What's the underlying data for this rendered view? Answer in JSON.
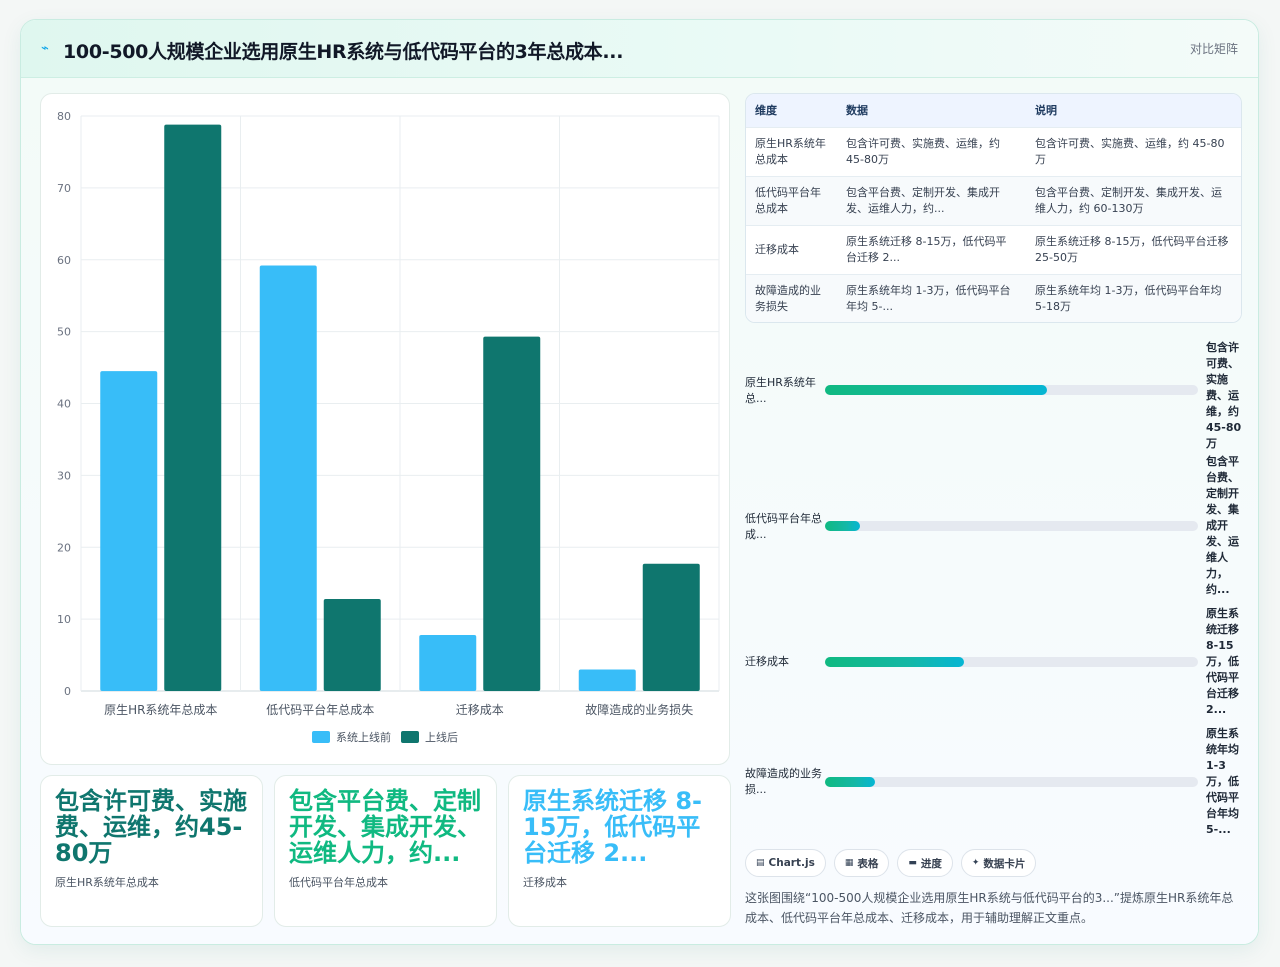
{
  "header": {
    "title": "100-500人规模企业选用原生HR系统与低代码平台的3年总成本...",
    "tag": "对比矩阵"
  },
  "chart_data": {
    "type": "bar",
    "categories": [
      "原生HR系统年总成本",
      "低代码平台年总成本",
      "迁移成本",
      "故障造成的业务损失"
    ],
    "series": [
      {
        "name": "系统上线前",
        "values": [
          44.5,
          59.2,
          7.8,
          3.0
        ],
        "color": "#38bdf8"
      },
      {
        "name": "上线后",
        "values": [
          78.8,
          12.8,
          49.3,
          17.7
        ],
        "color": "#0f766e"
      }
    ],
    "yticks": [
      "0",
      "10",
      "20",
      "30",
      "40",
      "50",
      "60",
      "70",
      "80"
    ],
    "ylim": [
      0,
      80
    ],
    "grid": true,
    "legend": "bottom"
  },
  "stats": [
    {
      "value": "包含许可费、实施费、运维，约45-80万",
      "label": "原生HR系统年总成本",
      "color": "#0f766e"
    },
    {
      "value": "包含平台费、定制开发、集成开发、运维人力，约...",
      "label": "低代码平台年总成本",
      "color": "#10b981"
    },
    {
      "value": "原生系统迁移 8-15万，低代码平台迁移 2...",
      "label": "迁移成本",
      "color": "#38bdf8"
    }
  ],
  "table": {
    "headers": [
      "维度",
      "数据",
      "说明"
    ],
    "rows": [
      [
        "原生HR系统年总成本",
        "包含许可费、实施费、运维，约45-80万",
        "包含许可费、实施费、运维，约 45-80万"
      ],
      [
        "低代码平台年总成本",
        "包含平台费、定制开发、集成开发、运维人力，约...",
        "包含平台费、定制开发、集成开发、运维人力，约 60-130万"
      ],
      [
        "迁移成本",
        "原生系统迁移 8-15万，低代码平台迁移 2...",
        "原生系统迁移 8-15万，低代码平台迁移 25-50万"
      ],
      [
        "故障造成的业务损失",
        "原生系统年均 1-3万，低代码平台年均 5-...",
        "原生系统年均 1-3万，低代码平台年均 5-18万"
      ]
    ]
  },
  "progress": [
    {
      "label": "原生HR系统年总...",
      "value": "包含许可费、实施费、运维，约45-80万",
      "fraction": 0.595
    },
    {
      "label": "低代码平台年总成...",
      "value": "包含平台费、定制开发、集成开发、运维人力，约...",
      "fraction": 0.095
    },
    {
      "label": "迁移成本",
      "value": "原生系统迁移8-15万，低代码平台迁移2...",
      "fraction": 0.372
    },
    {
      "label": "故障造成的业务损...",
      "value": "原生系统年均1-3万，低代码平台年均5-...",
      "fraction": 0.135
    }
  ],
  "chips": [
    {
      "icon": "▤",
      "label": "Chart.js"
    },
    {
      "icon": "▦",
      "label": "表格"
    },
    {
      "icon": "▬",
      "label": "进度"
    },
    {
      "icon": "✦",
      "label": "数据卡片"
    }
  ],
  "summary": "这张图围绕“100-500人规模企业选用原生HR系统与低代码平台的3...”提炼原生HR系统年总成本、低代码平台年总成本、迁移成本，用于辅助理解正文重点。"
}
